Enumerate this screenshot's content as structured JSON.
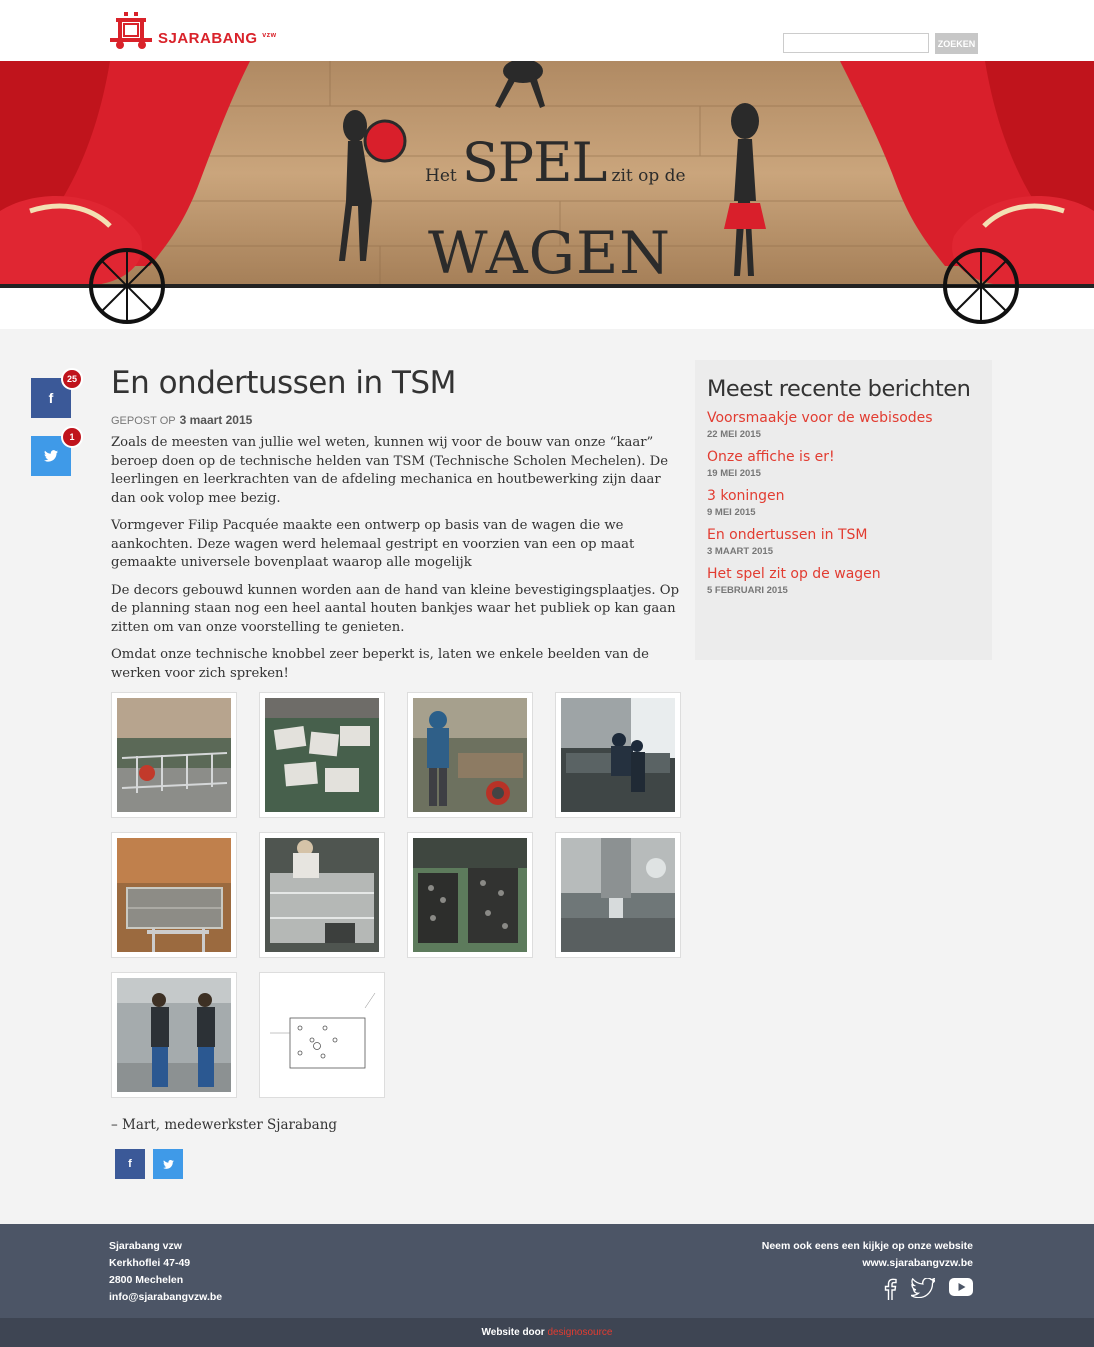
{
  "header": {
    "logo_text": "SJARABANG",
    "logo_suffix": "vzw",
    "search_placeholder": "",
    "search_button": "ZOEKEN"
  },
  "banner": {
    "line1_small_left": "Het",
    "line1_big": "SPEL",
    "line1_small_right": "zit op de",
    "line2": "WAGEN"
  },
  "share_side": [
    {
      "network": "facebook",
      "icon": "facebook-icon",
      "count": "25",
      "color": "#3b5998"
    },
    {
      "network": "twitter",
      "icon": "twitter-icon",
      "count": "1",
      "color": "#3f9ae8"
    }
  ],
  "article": {
    "title": "En ondertussen in TSM",
    "meta_label": "GEPOST OP",
    "meta_date": "3 maart 2015",
    "paragraphs": [
      "Zoals de meesten van jullie wel weten, kunnen wij voor de bouw van onze “kaar” beroep doen op de technische helden van TSM (Technische Scholen Mechelen). De leerlingen en leerkrachten van de afdeling mechanica en houtbewerking zijn daar dan ook volop mee bezig.",
      "Vormgever Filip Pacquée maakte een ontwerp op basis van de wagen die we aankochten. Deze wagen werd helemaal gestript en voorzien van een op maat gemaakte universele bovenplaat waarop alle mogelijk",
      "De decors gebouwd kunnen worden aan de hand van kleine bevestigingsplaatjes. Op de planning staan nog een heel aantal houten bankjes waar het publiek op kan gaan zitten om van onze voorstelling te genieten.",
      "Omdat onze technische knobbel zeer beperkt is, laten we enkele beelden van de werken voor zich spreken!"
    ],
    "signature": "– Mart, medewerkster Sjarabang"
  },
  "sidebar": {
    "title": "Meest recente berichten",
    "posts": [
      {
        "title": "Voorsmaakje voor de webisodes",
        "date": "22 MEI 2015"
      },
      {
        "title": "Onze affiche is er!",
        "date": "19 MEI 2015"
      },
      {
        "title": "3 koningen",
        "date": "9 MEI 2015"
      },
      {
        "title": "En ondertussen in TSM",
        "date": "3 MAART 2015"
      },
      {
        "title": "Het spel zit op de wagen",
        "date": "5 FEBRUARI 2015"
      }
    ]
  },
  "footer": {
    "org": "Sjarabang vzw",
    "street": "Kerkhoflei 47-49",
    "city": "2800 Mechelen",
    "email": "info@sjarabangvzw.be",
    "right_line1": "Neem ook eens een kijkje op onze website",
    "right_line2": "www.sjarabangvzw.be",
    "credit_prefix": "Website door",
    "credit_link": "designosource"
  },
  "colors": {
    "accent": "#e23c31",
    "brand_red": "#d9222a",
    "footer_bg": "#4c5566",
    "facebook": "#3b5998",
    "twitter": "#3f9ae8"
  }
}
